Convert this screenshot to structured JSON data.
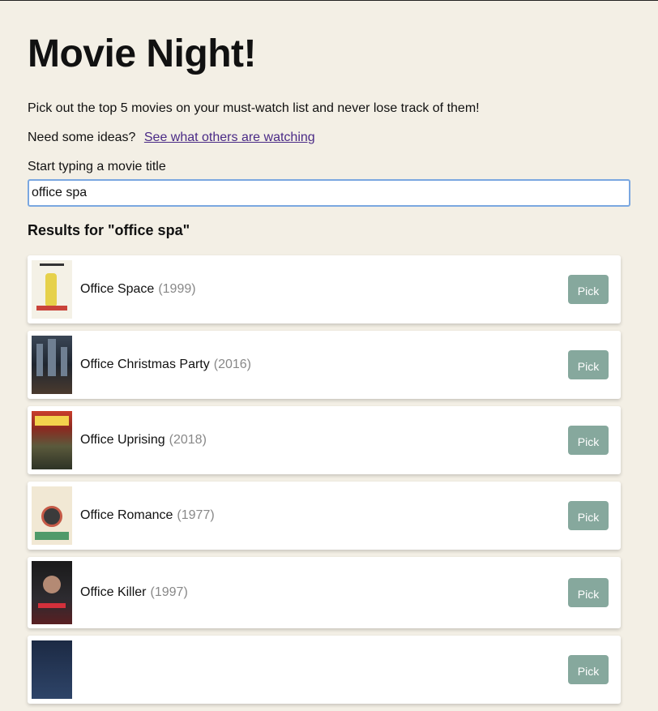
{
  "header": {
    "title": "Movie Night!",
    "intro": "Pick out the top 5 movies on your must-watch list and never lose track of them!",
    "ideas_prefix": "Need some ideas?",
    "ideas_link": "See what others are watching"
  },
  "search": {
    "label": "Start typing a movie title",
    "value": "office spa"
  },
  "results": {
    "heading": "Results for \"office spa\"",
    "items": [
      {
        "title": "Office Space",
        "year": "(1999)",
        "action": "Pick"
      },
      {
        "title": "Office Christmas Party",
        "year": "(2016)",
        "action": "Pick"
      },
      {
        "title": "Office Uprising",
        "year": "(2018)",
        "action": "Pick"
      },
      {
        "title": "Office Romance",
        "year": "(1977)",
        "action": "Pick"
      },
      {
        "title": "Office Killer",
        "year": "(1997)",
        "action": "Pick"
      },
      {
        "title": "",
        "year": "",
        "action": "Pick"
      }
    ]
  },
  "colors": {
    "background": "#f3efe5",
    "pick_button": "#86a89d",
    "link": "#4a2a86",
    "search_border": "#7aa7e0"
  }
}
